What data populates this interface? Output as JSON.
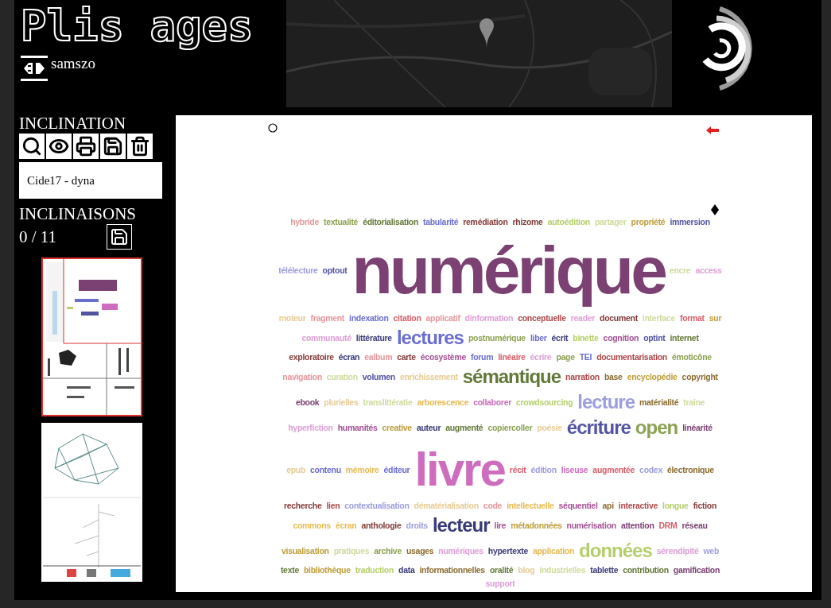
{
  "app": {
    "title": "Plis ages",
    "user": "samszo"
  },
  "sidebar": {
    "section_title": "INCLINATION",
    "name_field": {
      "value": "Cide17 - dyna"
    },
    "list_title": "INCLINAISONS",
    "counter": "0 / 11",
    "thumbnails": [
      {
        "kind": "cloud",
        "selected": true
      },
      {
        "kind": "graph",
        "selected": false
      }
    ]
  },
  "canvas": {
    "words": [
      {
        "text": "hybride",
        "color": "#e7969c",
        "kind": "small"
      },
      {
        "text": "textualité",
        "color": "#8ca252",
        "kind": "small"
      },
      {
        "text": "éditorialisation",
        "color": "#637939",
        "kind": "small"
      },
      {
        "text": "tabularité",
        "color": "#6b6ecf",
        "kind": "small"
      },
      {
        "text": "remédiation",
        "color": "#843c39",
        "kind": "small"
      },
      {
        "text": "rhizome",
        "color": "#843c39",
        "kind": "small"
      },
      {
        "text": "autoédition",
        "color": "#b5cf6b",
        "kind": "small"
      },
      {
        "text": "partager",
        "color": "#cedb9c",
        "kind": "small"
      },
      {
        "text": "propriété",
        "color": "#bd9e39",
        "kind": "small"
      },
      {
        "text": "immersion",
        "color": "#5254a3",
        "kind": "small"
      },
      {
        "text": "télélecture",
        "color": "#9c9ede",
        "kind": "small"
      },
      {
        "text": "optout",
        "color": "#5254a3",
        "kind": "small"
      },
      {
        "text": "numérique",
        "color": "#7b4173",
        "kind": "main"
      },
      {
        "text": "encre",
        "color": "#cedb9c",
        "kind": "small"
      },
      {
        "text": "access",
        "color": "#de9ed6",
        "kind": "small"
      },
      {
        "text": "moteur",
        "color": "#e7cb94",
        "kind": "small"
      },
      {
        "text": "fragment",
        "color": "#e7969c",
        "kind": "small"
      },
      {
        "text": "indexation",
        "color": "#6b6ecf",
        "kind": "small"
      },
      {
        "text": "citation",
        "color": "#d6616b",
        "kind": "small"
      },
      {
        "text": "applicatif",
        "color": "#e7969c",
        "kind": "small"
      },
      {
        "text": "dinformation",
        "color": "#de9ed6",
        "kind": "small"
      },
      {
        "text": "conceptuelle",
        "color": "#ad494a",
        "kind": "small"
      },
      {
        "text": "reader",
        "color": "#de9ed6",
        "kind": "small"
      },
      {
        "text": "document",
        "color": "#843c39",
        "kind": "small"
      },
      {
        "text": "interface",
        "color": "#cedb9c",
        "kind": "small"
      },
      {
        "text": "format",
        "color": "#d6616b",
        "kind": "small"
      },
      {
        "text": "sur",
        "color": "#bd9e39",
        "kind": "small"
      },
      {
        "text": "communauté",
        "color": "#de9ed6",
        "kind": "small"
      },
      {
        "text": "littérature",
        "color": "#393b79",
        "kind": "small"
      },
      {
        "text": "lectures",
        "color": "#6b6ecf",
        "kind": "large"
      },
      {
        "text": "postnumérique",
        "color": "#8ca252",
        "kind": "small"
      },
      {
        "text": "liber",
        "color": "#6b6ecf",
        "kind": "small"
      },
      {
        "text": "écrit",
        "color": "#393b79",
        "kind": "small"
      },
      {
        "text": "binette",
        "color": "#b5cf6b",
        "kind": "small"
      },
      {
        "text": "cognition",
        "color": "#a55194",
        "kind": "small"
      },
      {
        "text": "optint",
        "color": "#5254a3",
        "kind": "small"
      },
      {
        "text": "internet",
        "color": "#637939",
        "kind": "small"
      },
      {
        "text": "exploratoire",
        "color": "#843c39",
        "kind": "small"
      },
      {
        "text": "écran",
        "color": "#393b79",
        "kind": "small"
      },
      {
        "text": "ealbum",
        "color": "#e7969c",
        "kind": "small"
      },
      {
        "text": "carte",
        "color": "#843c39",
        "kind": "small"
      },
      {
        "text": "écosystème",
        "color": "#a55194",
        "kind": "small"
      },
      {
        "text": "forum",
        "color": "#6b6ecf",
        "kind": "small"
      },
      {
        "text": "linéaire",
        "color": "#d6616b",
        "kind": "small"
      },
      {
        "text": "écrire",
        "color": "#de9ed6",
        "kind": "small"
      },
      {
        "text": "page",
        "color": "#8ca252",
        "kind": "small"
      },
      {
        "text": "TEI",
        "color": "#6b6ecf",
        "kind": "small"
      },
      {
        "text": "documentarisation",
        "color": "#ad494a",
        "kind": "small"
      },
      {
        "text": "émoticône",
        "color": "#8ca252",
        "kind": "small"
      },
      {
        "text": "navigation",
        "color": "#e7969c",
        "kind": "small"
      },
      {
        "text": "curation",
        "color": "#cedb9c",
        "kind": "small"
      },
      {
        "text": "volumen",
        "color": "#5254a3",
        "kind": "small"
      },
      {
        "text": "enrichissement",
        "color": "#e7cb94",
        "kind": "small"
      },
      {
        "text": "sémantique",
        "color": "#637939",
        "kind": "large"
      },
      {
        "text": "narration",
        "color": "#ad494a",
        "kind": "small"
      },
      {
        "text": "base",
        "color": "#8c6d31",
        "kind": "small"
      },
      {
        "text": "encyclopédie",
        "color": "#bd9e39",
        "kind": "small"
      },
      {
        "text": "copyright",
        "color": "#8c6d31",
        "kind": "small"
      },
      {
        "text": "ebook",
        "color": "#7b4173",
        "kind": "small"
      },
      {
        "text": "plurielles",
        "color": "#e7cb94",
        "kind": "small"
      },
      {
        "text": "translittératie",
        "color": "#cedb9c",
        "kind": "small"
      },
      {
        "text": "arborescence",
        "color": "#e7ba52",
        "kind": "small"
      },
      {
        "text": "collaborer",
        "color": "#ce6dbd",
        "kind": "small"
      },
      {
        "text": "crowdsourcing",
        "color": "#b5cf6b",
        "kind": "small"
      },
      {
        "text": "lecture",
        "color": "#9c9ede",
        "kind": "large"
      },
      {
        "text": "matérialité",
        "color": "#8c6d31",
        "kind": "small"
      },
      {
        "text": "traîne",
        "color": "#cedb9c",
        "kind": "small"
      },
      {
        "text": "hyperfiction",
        "color": "#de9ed6",
        "kind": "small"
      },
      {
        "text": "humanités",
        "color": "#a55194",
        "kind": "small"
      },
      {
        "text": "creative",
        "color": "#bd9e39",
        "kind": "small"
      },
      {
        "text": "auteur",
        "color": "#393b79",
        "kind": "small"
      },
      {
        "text": "augmenté",
        "color": "#637939",
        "kind": "small"
      },
      {
        "text": "copiercoller",
        "color": "#8ca252",
        "kind": "small"
      },
      {
        "text": "poésie",
        "color": "#e7cb94",
        "kind": "small"
      },
      {
        "text": "écriture",
        "color": "#5254a3",
        "kind": "large"
      },
      {
        "text": "open",
        "color": "#8ca252",
        "kind": "large"
      },
      {
        "text": "linéarité",
        "color": "#7b4173",
        "kind": "small"
      },
      {
        "text": "epub",
        "color": "#e7cb94",
        "kind": "small"
      },
      {
        "text": "contenu",
        "color": "#6b6ecf",
        "kind": "small"
      },
      {
        "text": "mémoire",
        "color": "#e7ba52",
        "kind": "small"
      },
      {
        "text": "éditeur",
        "color": "#6b6ecf",
        "kind": "small"
      },
      {
        "text": "livre",
        "color": "#ce6dbd",
        "kind": "major"
      },
      {
        "text": "récit",
        "color": "#d6616b",
        "kind": "small"
      },
      {
        "text": "édition",
        "color": "#9c9ede",
        "kind": "small"
      },
      {
        "text": "liseuse",
        "color": "#ce6dbd",
        "kind": "small"
      },
      {
        "text": "augmentée",
        "color": "#d6616b",
        "kind": "small"
      },
      {
        "text": "codex",
        "color": "#9c9ede",
        "kind": "small"
      },
      {
        "text": "électronique",
        "color": "#8c6d31",
        "kind": "small"
      },
      {
        "text": "recherche",
        "color": "#843c39",
        "kind": "small"
      },
      {
        "text": "lien",
        "color": "#ad494a",
        "kind": "small"
      },
      {
        "text": "contextualisation",
        "color": "#9c9ede",
        "kind": "small"
      },
      {
        "text": "dématérialisation",
        "color": "#e7cb94",
        "kind": "small"
      },
      {
        "text": "code",
        "color": "#e7969c",
        "kind": "small"
      },
      {
        "text": "intellectuelle",
        "color": "#e7ba52",
        "kind": "small"
      },
      {
        "text": "séquentiel",
        "color": "#a55194",
        "kind": "small"
      },
      {
        "text": "api",
        "color": "#8c6d31",
        "kind": "small"
      },
      {
        "text": "interactive",
        "color": "#ad494a",
        "kind": "small"
      },
      {
        "text": "longue",
        "color": "#b5cf6b",
        "kind": "small"
      },
      {
        "text": "fiction",
        "color": "#843c39",
        "kind": "small"
      },
      {
        "text": "commons",
        "color": "#e7ba52",
        "kind": "small"
      },
      {
        "text": "écran",
        "color": "#e7ba52",
        "kind": "small"
      },
      {
        "text": "anthologie",
        "color": "#843c39",
        "kind": "small"
      },
      {
        "text": "droits",
        "color": "#9c9ede",
        "kind": "small"
      },
      {
        "text": "lecteur",
        "color": "#393b79",
        "kind": "large"
      },
      {
        "text": "lire",
        "color": "#a55194",
        "kind": "small"
      },
      {
        "text": "métadonnées",
        "color": "#bd9e39",
        "kind": "small"
      },
      {
        "text": "numérisation",
        "color": "#a55194",
        "kind": "small"
      },
      {
        "text": "attention",
        "color": "#7b4173",
        "kind": "small"
      },
      {
        "text": "DRM",
        "color": "#d6616b",
        "kind": "small"
      },
      {
        "text": "réseau",
        "color": "#7b4173",
        "kind": "small"
      },
      {
        "text": "visualisation",
        "color": "#bd9e39",
        "kind": "small"
      },
      {
        "text": "pratiques",
        "color": "#cedb9c",
        "kind": "small"
      },
      {
        "text": "archive",
        "color": "#8ca252",
        "kind": "small"
      },
      {
        "text": "usages",
        "color": "#8c6d31",
        "kind": "small"
      },
      {
        "text": "numériques",
        "color": "#de9ed6",
        "kind": "small"
      },
      {
        "text": "hypertexte",
        "color": "#393b79",
        "kind": "small"
      },
      {
        "text": "application",
        "color": "#e7ba52",
        "kind": "small"
      },
      {
        "text": "données",
        "color": "#b5cf6b",
        "kind": "large"
      },
      {
        "text": "sérendipité",
        "color": "#de9ed6",
        "kind": "small"
      },
      {
        "text": "web",
        "color": "#9c9ede",
        "kind": "small"
      },
      {
        "text": "texte",
        "color": "#637939",
        "kind": "small"
      },
      {
        "text": "bibliothèque",
        "color": "#bd9e39",
        "kind": "small"
      },
      {
        "text": "traduction",
        "color": "#b5cf6b",
        "kind": "small"
      },
      {
        "text": "data",
        "color": "#393b79",
        "kind": "small"
      },
      {
        "text": "informationnelles",
        "color": "#8c6d31",
        "kind": "small"
      },
      {
        "text": "oralité",
        "color": "#637939",
        "kind": "small"
      },
      {
        "text": "blog",
        "color": "#e7cb94",
        "kind": "small"
      },
      {
        "text": "industrielles",
        "color": "#cedb9c",
        "kind": "small"
      },
      {
        "text": "tablette",
        "color": "#393b79",
        "kind": "small"
      },
      {
        "text": "contribution",
        "color": "#637939",
        "kind": "small"
      },
      {
        "text": "gamification",
        "color": "#7b4173",
        "kind": "small"
      },
      {
        "text": "support",
        "color": "#de9ed6",
        "kind": "small"
      }
    ]
  }
}
